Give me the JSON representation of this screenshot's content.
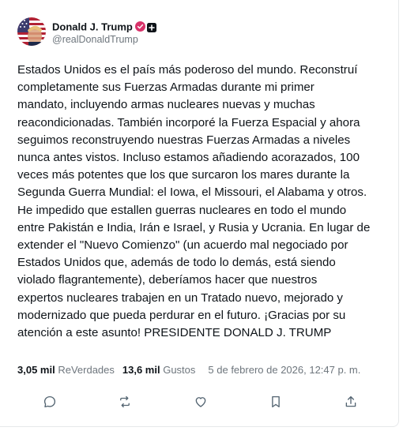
{
  "post": {
    "author": {
      "display_name": "Donald J. Trump",
      "handle": "@realDonaldTrump",
      "verified_icon": "verified-badge-icon",
      "extra_badge_icon": "plus-square-icon"
    },
    "text_lines": [
      "Estados Unidos es el país más poderoso del mundo. Reconstruí",
      "completamente sus Fuerzas Armadas durante mi primer",
      "mandato, incluyendo armas nucleares nuevas y muchas",
      "reacondicionadas. También incorporé la Fuerza Espacial y ahora",
      "seguimos reconstruyendo nuestras Fuerzas Armadas a niveles",
      "nunca antes vistos. Incluso estamos añadiendo acorazados, 100",
      "veces más potentes que los que surcaron los mares durante la",
      "Segunda Guerra Mundial: el Iowa, el Missouri, el Alabama y otros.",
      "He impedido que estallen guerras nucleares en todo el mundo",
      "entre Pakistán e India, Irán e Israel, y Rusia y Ucrania. En lugar de",
      "extender el \"Nuevo Comienzo\" (un acuerdo mal negociado por",
      "Estados Unidos que, además de todo lo demás, está siendo",
      "violado flagrantemente), deberíamos hacer que nuestros",
      "expertos nucleares trabajen en un Tratado nuevo, mejorado y",
      "modernizado que pueda perdurar en el futuro. ¡Gracias por su",
      "atención a este asunto! PRESIDENTE DONALD J. TRUMP"
    ],
    "stats": {
      "reposts_count": "3,05 mil",
      "reposts_label": "ReVerdades",
      "likes_count": "13,6 mil",
      "likes_label": "Gustos",
      "timestamp": "5 de febrero de 2026, 12:47 p. m."
    },
    "actions": [
      {
        "name": "reply",
        "icon": "reply-icon"
      },
      {
        "name": "retruth",
        "icon": "repost-icon"
      },
      {
        "name": "like",
        "icon": "heart-icon"
      },
      {
        "name": "bookmark",
        "icon": "bookmark-icon"
      },
      {
        "name": "share",
        "icon": "share-icon"
      }
    ],
    "colors": {
      "text": "#0f1419",
      "muted": "#6e767d",
      "verified": "#d8326a",
      "border": "#e6e8ea"
    }
  }
}
